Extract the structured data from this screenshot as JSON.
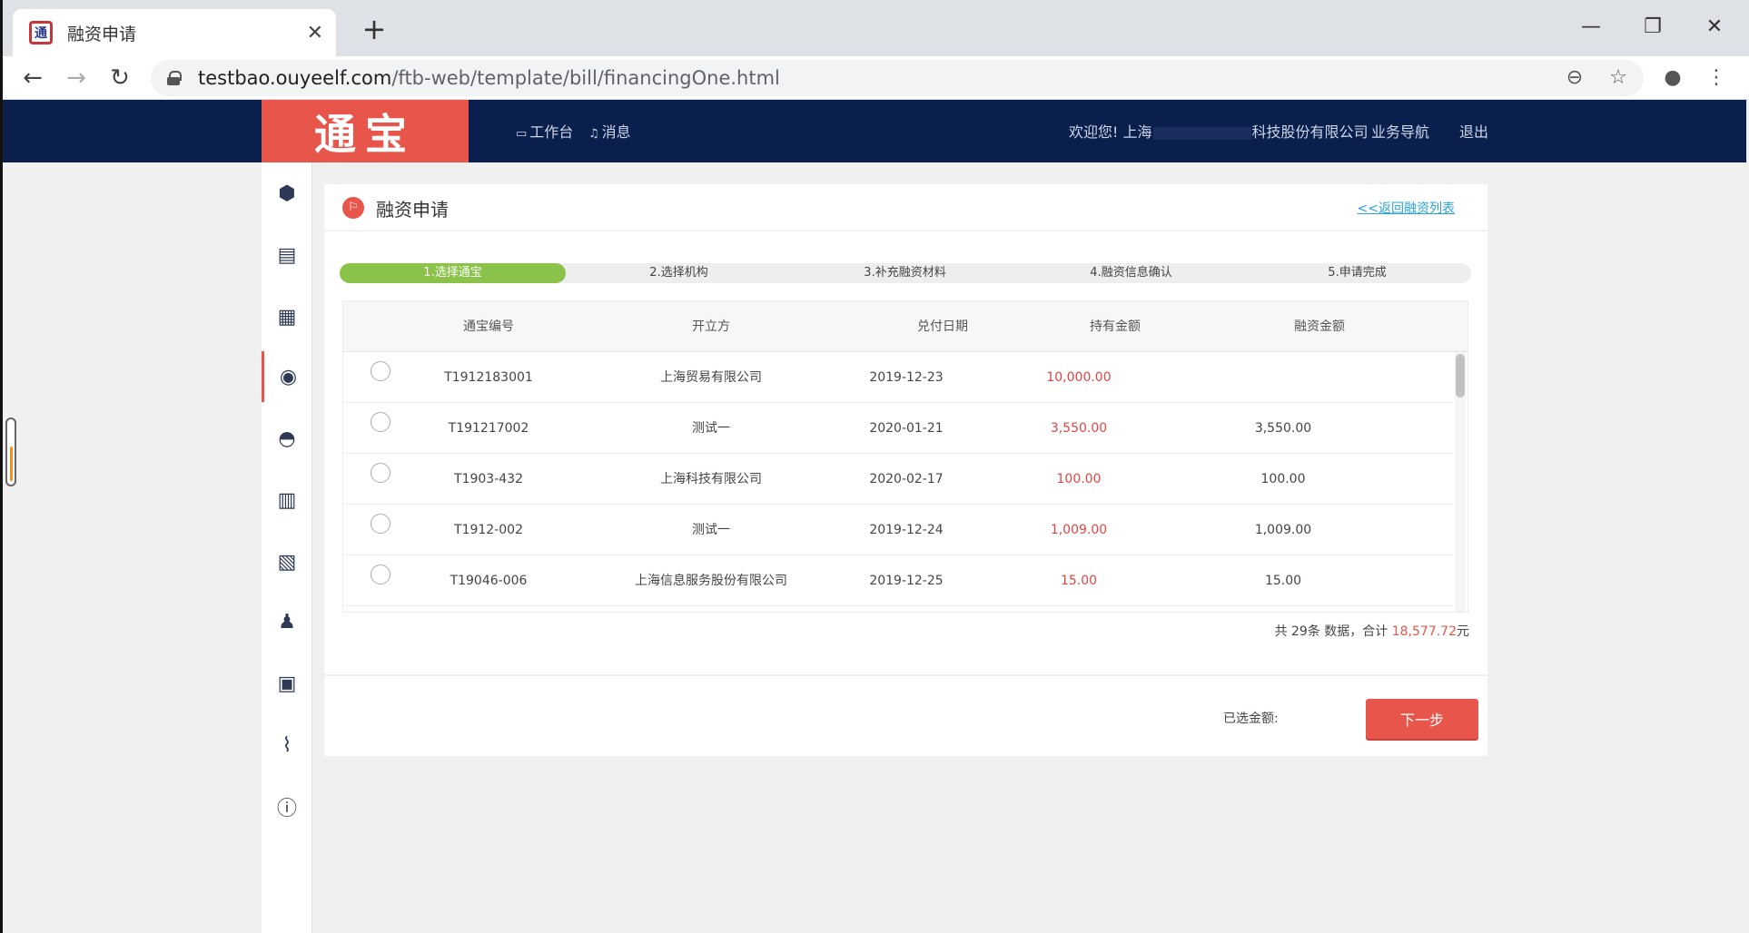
{
  "browser": {
    "tab_title": "融资申请",
    "tab_close": "✕",
    "new_tab": "+",
    "url_host": "testbao.ouyeelf.com",
    "url_path": "/ftb-web/template/bill/financingOne.html"
  },
  "header": {
    "logo": "通宝",
    "workbench": "工作台",
    "messages": "消息",
    "welcome": "欢迎您! 上海",
    "company_suffix": "科技股份有限公司",
    "biz_nav": "业务导航",
    "logout": "退出"
  },
  "page": {
    "title": "融资申请",
    "back_link": "<<返回融资列表"
  },
  "steps": [
    {
      "label": "1.选择通宝",
      "active": true
    },
    {
      "label": "2.选择机构",
      "active": false
    },
    {
      "label": "3.补充融资材料",
      "active": false
    },
    {
      "label": "4.融资信息确认",
      "active": false
    },
    {
      "label": "5.申请完成",
      "active": false
    }
  ],
  "table": {
    "headers": [
      "通宝编号",
      "开立方",
      "兑付日期",
      "持有金额",
      "融资金额"
    ],
    "rows": [
      {
        "code": "T1912183001",
        "issuer": "上海贸易有限公司",
        "date": "2019-12-23",
        "held": "10,000.00",
        "financing": ""
      },
      {
        "code": "T191217002",
        "issuer": "测试一",
        "date": "2020-01-21",
        "held": "3,550.00",
        "financing": "3,550.00"
      },
      {
        "code": "T1903-432",
        "issuer": "上海科技有限公司",
        "date": "2020-02-17",
        "held": "100.00",
        "financing": "100.00"
      },
      {
        "code": "T1912-002",
        "issuer": "测试一",
        "date": "2019-12-24",
        "held": "1,009.00",
        "financing": "1,009.00"
      },
      {
        "code": "T19046-006",
        "issuer": "上海信息服务股份有限公司",
        "date": "2019-12-25",
        "held": "15.00",
        "financing": "15.00"
      }
    ]
  },
  "summary": {
    "prefix": "共 29条 数据，合计 ",
    "total": "18,577.72",
    "suffix": "元"
  },
  "footer": {
    "selected_label": "已选金额:",
    "next_button": "下一步"
  },
  "sidebar_icons": [
    "box-icon",
    "bill-transfer-icon",
    "calendar-bill-icon",
    "coins-icon",
    "ingot-icon",
    "document-list-icon",
    "stack-icon",
    "user-settings-icon",
    "verified-doc-icon",
    "attachment-icon",
    "alert-icon"
  ],
  "colors": {
    "header_bg": "#0b1f4d",
    "brand_red": "#e8554a",
    "step_active": "#8bc34a",
    "amount_red": "#e04545",
    "link_blue": "#29a3d6"
  }
}
